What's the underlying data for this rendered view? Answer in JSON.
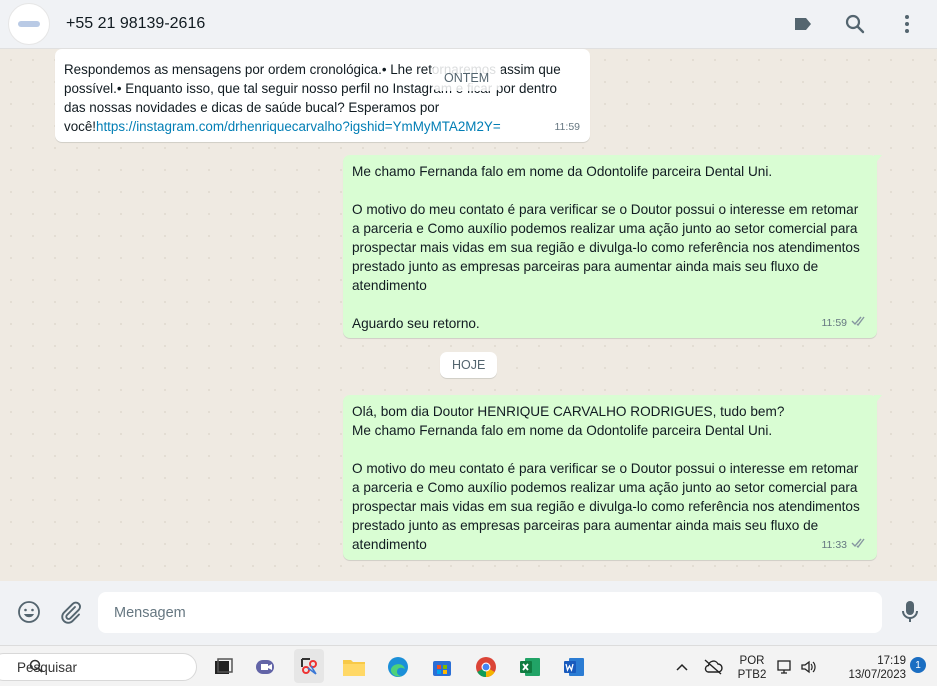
{
  "header": {
    "contact_name": "+55 21 98139-2616"
  },
  "messages": {
    "first_in": {
      "text_line1": "Respondemos as mensagens por ordem cronológica.• Lhe retornaremos assim que",
      "text_line2": "possível.• Enquanto isso, que tal seguir nosso perfil no Instagram e ficar por dentro",
      "text_line3": "das nossas novidades e dicas de saúde bucal? Esperamos por",
      "text_prefix": "você!",
      "link": "https://instagram.com/drhenriquecarvalho?igshid=YmMyMTA2M2Y=",
      "time": "11:59"
    },
    "date_yesterday": "ONTEM",
    "out_1": {
      "text": "Me chamo Fernanda falo em nome da Odontolife parceira Dental Uni.\n\nO motivo do meu contato é para verificar se o Doutor possui o interesse em retomar a parceria e Como auxílio podemos realizar uma ação junto ao setor comercial para prospectar mais vidas em sua região e divulga-lo como referência nos atendimentos prestado junto as empresas parceiras para aumentar ainda mais seu fluxo de atendimento\n\nAguardo seu retorno.",
      "time": "11:59"
    },
    "date_today": "HOJE",
    "out_2": {
      "text": "Olá, bom dia  Doutor HENRIQUE CARVALHO RODRIGUES, tudo bem?\nMe chamo Fernanda falo em nome da Odontolife parceira Dental Uni.\n\nO motivo do meu contato é para verificar se o Doutor possui o interesse em retomar a parceria e Como auxílio podemos realizar uma ação junto ao setor comercial para prospectar mais vidas em sua região e divulga-lo como referência nos atendimentos prestado junto as empresas parceiras para aumentar ainda mais seu fluxo de atendimento",
      "time": "11:33"
    }
  },
  "composer": {
    "placeholder": "Mensagem"
  },
  "taskbar": {
    "search_label": "Pesquisar",
    "lang_line1": "POR",
    "lang_line2": "PTB2",
    "clock_time": "17:19",
    "clock_date": "13/07/2023",
    "notification_count": "1"
  },
  "colors": {
    "outgoing_bubble": "#d9fdd3",
    "incoming_bubble": "#ffffff",
    "link": "#027eb5",
    "chat_bg": "#efeae2"
  }
}
